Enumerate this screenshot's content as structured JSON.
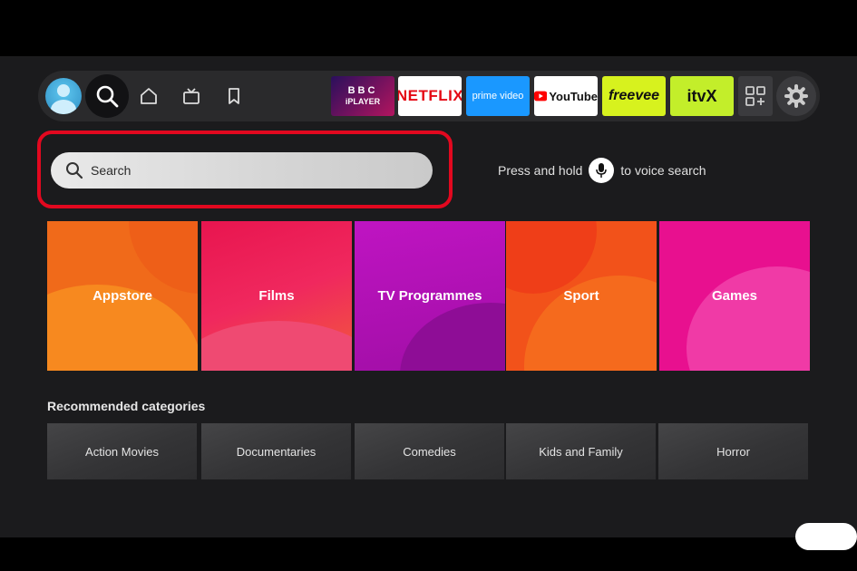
{
  "search": {
    "placeholder": "Search"
  },
  "voice": {
    "before": "Press and hold",
    "after": "to voice search"
  },
  "apps": {
    "bbc_line1": "BBC",
    "bbc_line2": "iPLAYER",
    "netflix": "NETFLIX",
    "prime": "prime video",
    "youtube": "YouTube",
    "freevee": "freevee",
    "itvx": "itvX"
  },
  "categories": [
    {
      "label": "Appstore"
    },
    {
      "label": "Films"
    },
    {
      "label": "TV Programmes"
    },
    {
      "label": "Sport"
    },
    {
      "label": "Games"
    }
  ],
  "recommended": {
    "title": "Recommended categories",
    "items": [
      {
        "label": "Action Movies"
      },
      {
        "label": "Documentaries"
      },
      {
        "label": "Comedies"
      },
      {
        "label": "Kids and Family"
      },
      {
        "label": "Horror"
      }
    ]
  },
  "colors": {
    "highlight": "#e2081f",
    "netflix_red": "#e50914",
    "prime_blue": "#1a98ff",
    "freevee_yellow": "#d7f21e",
    "itvx_green": "#c3ee2a"
  }
}
